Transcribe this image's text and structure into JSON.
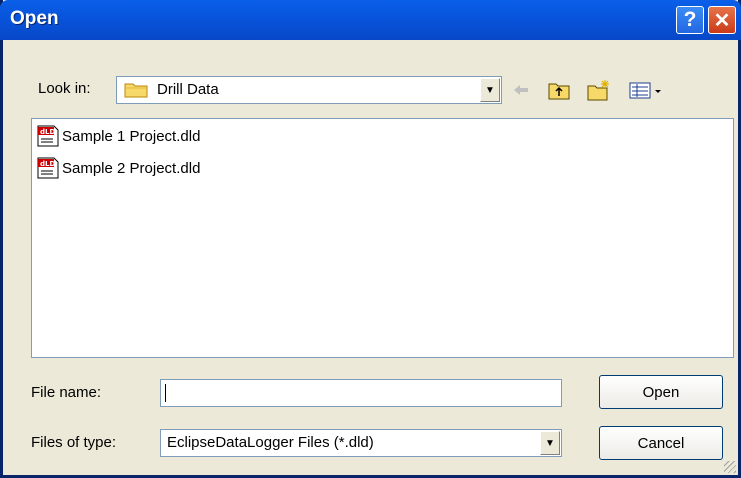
{
  "window": {
    "title": "Open"
  },
  "title_buttons": {
    "help": "?",
    "close": "✕"
  },
  "look_in": {
    "label": "Look in:",
    "value": "Drill Data"
  },
  "files": [
    {
      "name": "Sample 1 Project.dld",
      "icon": "dld-file-icon"
    },
    {
      "name": "Sample 2 Project.dld",
      "icon": "dld-file-icon"
    }
  ],
  "file_name": {
    "label": "File name:",
    "value": ""
  },
  "file_type": {
    "label": "Files of type:",
    "value": "EclipseDataLogger Files (*.dld)"
  },
  "buttons": {
    "open": "Open",
    "cancel": "Cancel"
  },
  "colors": {
    "title_bar": "#0855DD",
    "dialog_bg": "#ECE9D8",
    "border": "#7F9DB9"
  }
}
